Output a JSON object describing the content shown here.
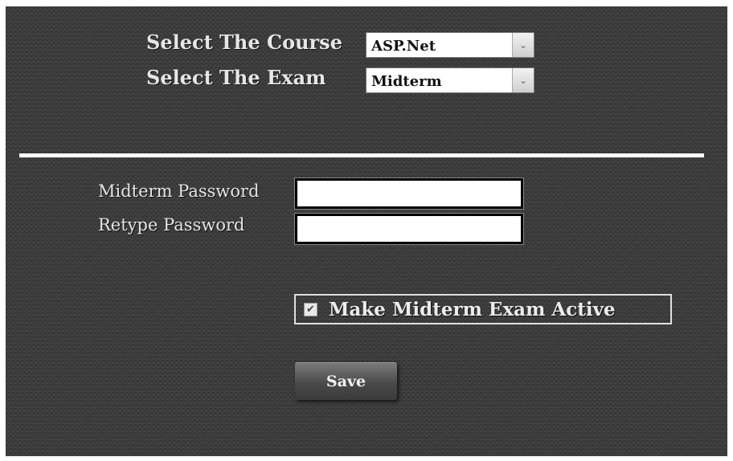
{
  "course": {
    "label": "Select The Course",
    "selected": "ASP.Net"
  },
  "exam": {
    "label": "Select The Exam",
    "selected": "Midterm"
  },
  "password": {
    "label": "Midterm Password",
    "value": ""
  },
  "retype": {
    "label": "Retype Password",
    "value": ""
  },
  "active": {
    "label": "Make Midterm Exam Active",
    "checked": true,
    "check_glyph": "✔"
  },
  "save": {
    "label": "Save"
  },
  "icons": {
    "dropdown_arrow": "⌄"
  }
}
